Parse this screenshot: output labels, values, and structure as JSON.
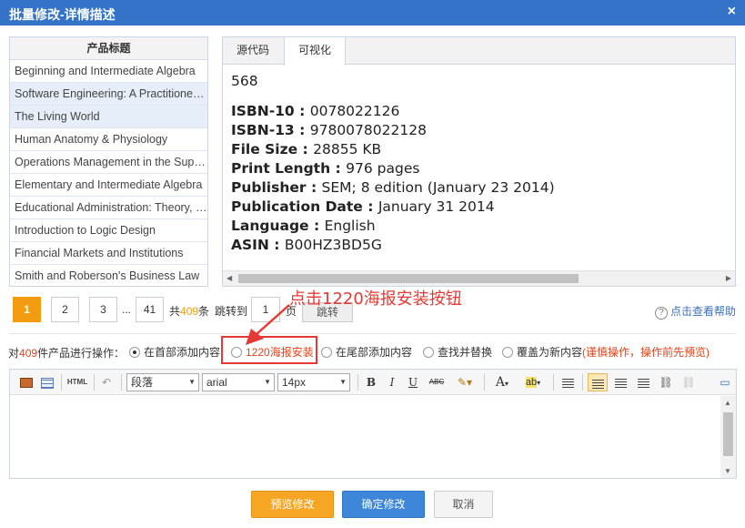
{
  "dialog": {
    "title": "批量修改-详情描述",
    "close": "×"
  },
  "product_list": {
    "header": "产品标题",
    "items": [
      "Beginning and Intermediate Algebra",
      "Software Engineering: A Practitioner's Approach",
      "The Living World",
      "Human Anatomy & Physiology",
      "Operations Management in the Supply Chain",
      "Elementary and Intermediate Algebra",
      "Educational Administration: Theory, Research, and Practice",
      "Introduction to Logic Design",
      "Financial Markets and Institutions",
      "Smith and Roberson's Business Law"
    ]
  },
  "detail": {
    "tabs": [
      "源代码",
      "可视化"
    ],
    "content": {
      "top": "568",
      "fields": [
        {
          "key": "ISBN-10",
          "value": "0078022126"
        },
        {
          "key": "ISBN-13",
          "value": "9780078022128"
        },
        {
          "key": "File Size",
          "value": "28855 KB"
        },
        {
          "key": "Print Length",
          "value": "976 pages"
        },
        {
          "key": "Publisher",
          "value": "SEM; 8 edition (January 23 2014)"
        },
        {
          "key": "Publication Date",
          "value": "January 31 2014"
        },
        {
          "key": "Language",
          "value": "English"
        },
        {
          "key": "ASIN",
          "value": "B00HZ3BD5G"
        }
      ]
    }
  },
  "pager": {
    "pages": [
      "1",
      "2",
      "3",
      "...",
      "41"
    ],
    "total_prefix": "共",
    "total": "409",
    "total_suffix": "条",
    "jump_label": "跳转到",
    "jump_value": "1",
    "page_unit": "页",
    "go": "跳转"
  },
  "help": {
    "icon": "?",
    "label": "点击查看帮助"
  },
  "annotation": "点击1220海报安装按钮",
  "operations": {
    "prefix": "对",
    "count": "409",
    "suffix": "件产品进行操作：",
    "options": [
      {
        "label": "在首部添加内容",
        "checked": true
      },
      {
        "label": "1220海报安装",
        "checked": false
      },
      {
        "label": "在尾部添加内容",
        "checked": false
      },
      {
        "label": "查找并替换",
        "checked": false
      },
      {
        "label": "覆盖为新内容",
        "note": "(谨慎操作，操作前先预览)",
        "checked": false
      }
    ]
  },
  "toolbar": {
    "html": "HTML",
    "paragraph": "段落",
    "font": "arial",
    "size": "14px",
    "bold": "B",
    "italic": "I",
    "underline": "U",
    "strike": "ABC",
    "fontcolor": "A",
    "bgcolor": "ab"
  },
  "buttons": {
    "preview": "预览修改",
    "confirm": "确定修改",
    "cancel": "取消"
  }
}
